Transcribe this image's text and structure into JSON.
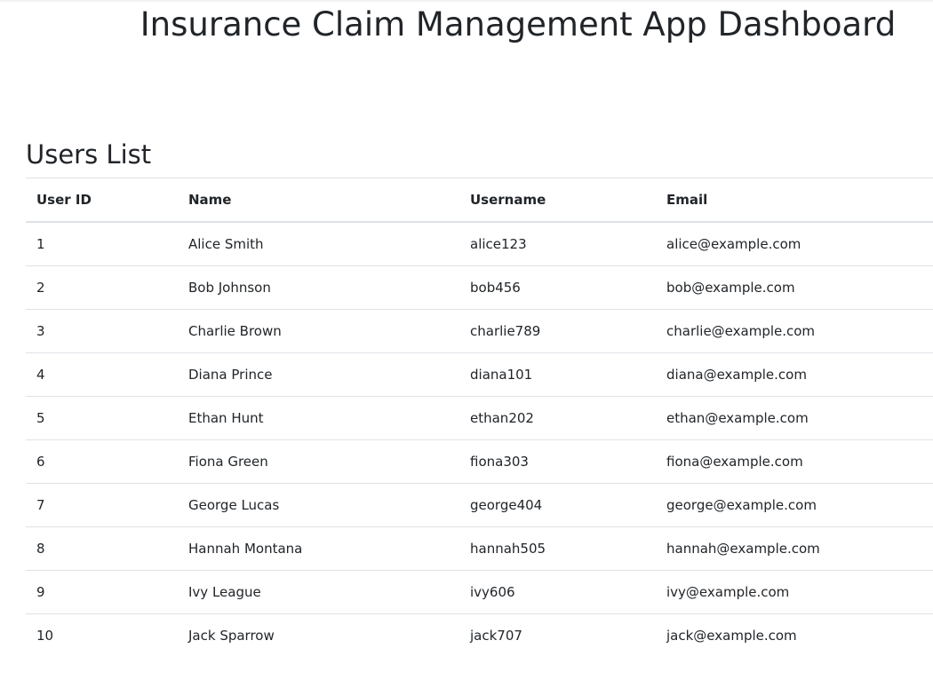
{
  "header": {
    "title": "Insurance Claim Management App Dashboard"
  },
  "users_section": {
    "title": "Users List",
    "columns": [
      "User ID",
      "Name",
      "Username",
      "Email"
    ],
    "rows": [
      [
        "1",
        "Alice Smith",
        "alice123",
        "alice@example.com"
      ],
      [
        "2",
        "Bob Johnson",
        "bob456",
        "bob@example.com"
      ],
      [
        "3",
        "Charlie Brown",
        "charlie789",
        "charlie@example.com"
      ],
      [
        "4",
        "Diana Prince",
        "diana101",
        "diana@example.com"
      ],
      [
        "5",
        "Ethan Hunt",
        "ethan202",
        "ethan@example.com"
      ],
      [
        "6",
        "Fiona Green",
        "fiona303",
        "fiona@example.com"
      ],
      [
        "7",
        "George Lucas",
        "george404",
        "george@example.com"
      ],
      [
        "8",
        "Hannah Montana",
        "hannah505",
        "hannah@example.com"
      ],
      [
        "9",
        "Ivy League",
        "ivy606",
        "ivy@example.com"
      ],
      [
        "10",
        "Jack Sparrow",
        "jack707",
        "jack@example.com"
      ]
    ]
  }
}
